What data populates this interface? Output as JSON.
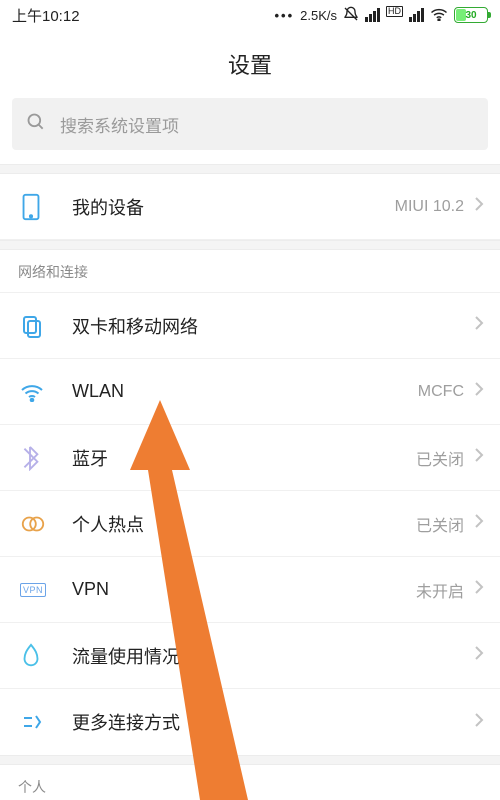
{
  "status": {
    "time": "上午10:12",
    "speed": "2.5K/s",
    "hd": "HD",
    "battery_pct": "30"
  },
  "title": "设置",
  "search": {
    "placeholder": "搜索系统设置项"
  },
  "device": {
    "label": "我的设备",
    "value": "MIUI 10.2"
  },
  "section1": {
    "header": "网络和连接"
  },
  "rows": {
    "sim": {
      "label": "双卡和移动网络",
      "value": ""
    },
    "wlan": {
      "label": "WLAN",
      "value": "MCFC"
    },
    "bt": {
      "label": "蓝牙",
      "value": "已关闭"
    },
    "hotspot": {
      "label": "个人热点",
      "value": "已关闭"
    },
    "vpn": {
      "label": "VPN",
      "value": "未开启"
    },
    "data": {
      "label": "流量使用情况",
      "value": ""
    },
    "more": {
      "label": "更多连接方式",
      "value": ""
    }
  },
  "section2": {
    "header": "个人"
  }
}
